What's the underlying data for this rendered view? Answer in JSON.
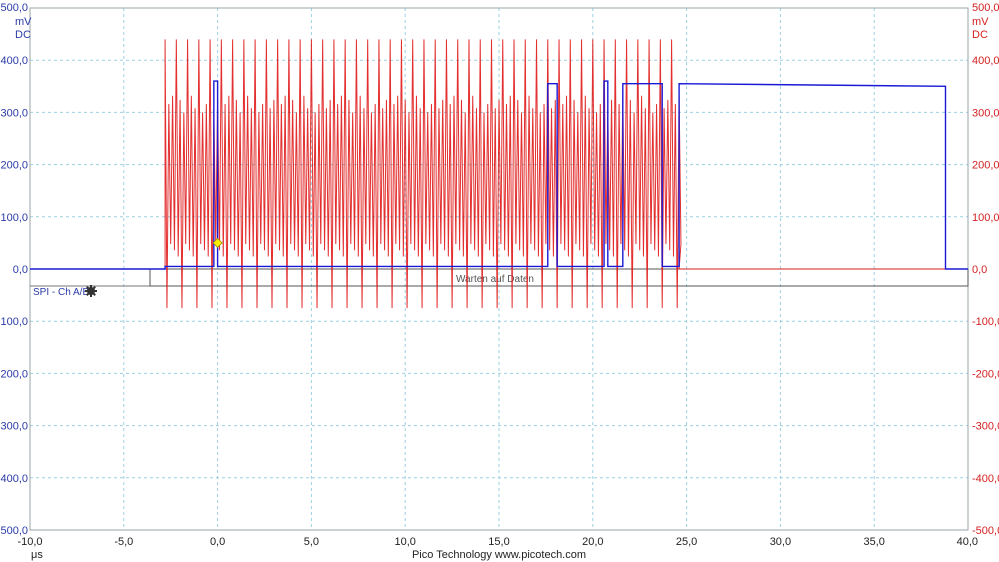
{
  "app": {
    "footer": "Pico Technology   www.picotech.com"
  },
  "colors": {
    "channel_a": "#1a1ad6",
    "channel_b": "#e01818",
    "grid": "#9cd0e0",
    "trigger_marker": "#ffee00",
    "serial_bar": "#777777"
  },
  "channels": [
    {
      "name": "A",
      "unit": "mV",
      "coupling": "DC",
      "axis_side": "left"
    },
    {
      "name": "B",
      "unit": "mV",
      "coupling": "DC",
      "axis_side": "right"
    }
  ],
  "serial_decoder": {
    "label": "SPI - Ch A/B",
    "icon": "gear-icon",
    "data_text": "Warten auf Daten"
  },
  "chart_data": {
    "type": "line",
    "title": "",
    "xlabel": "μs",
    "ylabel": "mV",
    "xlim": [
      -10,
      40
    ],
    "ylim": [
      -500,
      500
    ],
    "grid": true,
    "x_ticks": [
      "-10,0",
      "-5,0",
      "0,0",
      "5,0",
      "10,0",
      "15,0",
      "20,0",
      "25,0",
      "30,0",
      "35,0",
      "40,0"
    ],
    "y_ticks": [
      "500,0",
      "400,0",
      "300,0",
      "200,0",
      "100,0",
      "0,0",
      "-100,0",
      "-200,0",
      "-300,0",
      "-400,0",
      "-500,0"
    ],
    "trigger_point": {
      "x": 0.0,
      "y": 50
    },
    "series": [
      {
        "color": "#1a1ad6",
        "x": [
          -10.0,
          -2.8,
          -2.8,
          -0.2,
          -0.2,
          0.0,
          0.0,
          17.6,
          17.6,
          18.1,
          18.1,
          20.6,
          20.6,
          20.8,
          20.8,
          21.6,
          21.6,
          23.7,
          23.7,
          24.6,
          24.6,
          38.8,
          38.8,
          40.0
        ],
        "y": [
          0,
          0,
          5,
          5,
          360,
          360,
          5,
          5,
          355,
          355,
          5,
          5,
          360,
          360,
          5,
          5,
          355,
          355,
          5,
          5,
          355,
          350,
          0,
          0
        ]
      },
      {
        "color": "#e01818",
        "burst": {
          "start": -2.8,
          "end": 24.6,
          "period": 0.2,
          "high": 300,
          "low": 60,
          "spike_high": 440,
          "spike_low": -75
        },
        "x": [
          -10.0,
          -2.8,
          24.6,
          40.0
        ],
        "y": [
          0,
          0,
          0,
          0
        ]
      }
    ]
  }
}
